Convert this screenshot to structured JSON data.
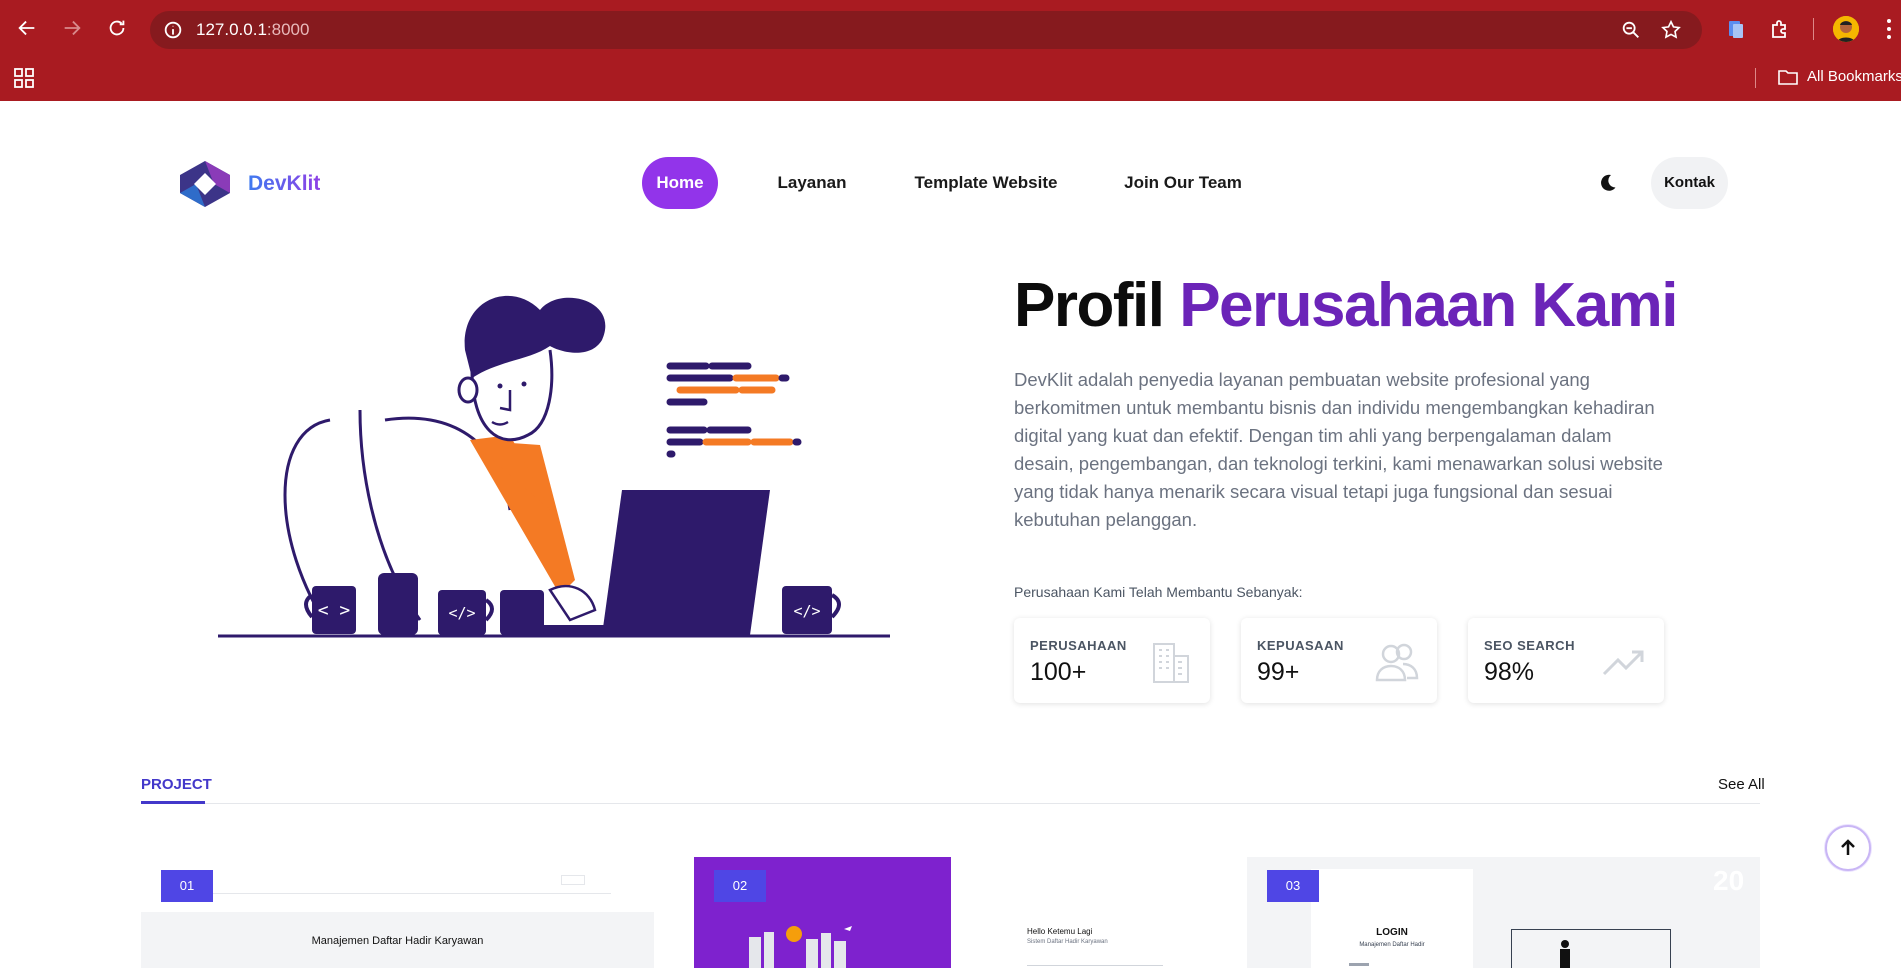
{
  "browser": {
    "url_host": "127.0.0.1",
    "url_port": ":8000",
    "bookmarks_label": "All Bookmarks"
  },
  "site": {
    "brand": "DevKlit",
    "nav": [
      "Home",
      "Layanan",
      "Template Website",
      "Join Our Team"
    ],
    "active_nav": "Home",
    "contact_label": "Kontak"
  },
  "hero": {
    "title_plain": "Profil",
    "title_accent": "Perusahaan Kami",
    "description": "DevKlit adalah penyedia layanan pembuatan website profesional yang berkomitmen untuk membantu bisnis dan individu mengembangkan kehadiran digital yang kuat dan efektif. Dengan tim ahli yang berpengalaman dalam desain, pengembangan, dan teknologi terkini, kami menawarkan solusi website yang tidak hanya menarik secara visual tetapi juga fungsional dan sesuai kebutuhan pelanggan.",
    "helped_label": "Perusahaan Kami Telah Membantu Sebanyak:",
    "stats": [
      {
        "label": "PERUSAHAAN",
        "value": "100+",
        "icon": "building-icon"
      },
      {
        "label": "KEPUASAAN",
        "value": "99+",
        "icon": "users-icon"
      },
      {
        "label": "SEO SEARCH",
        "value": "98%",
        "icon": "trending-up-icon"
      }
    ]
  },
  "projects": {
    "tab_label": "PROJECT",
    "see_all": "See All",
    "badges": [
      "01",
      "02",
      "03"
    ],
    "card1_title": "Manajemen Daftar Hadir Karyawan",
    "card2_greeting": "Hello Ketemu Lagi",
    "card2_sub": "Sistem Daftar Hadir Karyawan",
    "card3_title": "LOGIN",
    "card3_sub": "Manajemen Daftar Hadir",
    "card3_num": "20"
  },
  "colors": {
    "chrome": "#a91b21",
    "accent_purple": "#9234ea",
    "title_accent": "#6b24b8",
    "badge": "#4f46e5"
  }
}
